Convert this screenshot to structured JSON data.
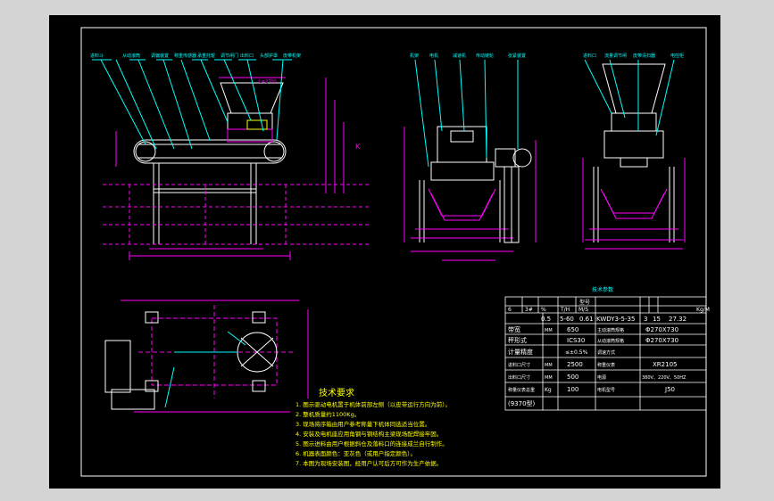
{
  "tech_notes": {
    "title": "技术要求",
    "items": [
      "1. 图示驱动电机置于机体前部左侧（以皮带运行方向为前）。",
      "2. 整机质量约1100Kg。",
      "3. 现场将序箱由用户参考称量下机体同选适当位置。",
      "4. 安装及电机座应用角钢与钢结构主梁现场配焊接牢固。",
      "5. 图示进料由用户根据斜仓及落料口的连接成兰自行制作。",
      "6. 机器表面颜色：亚灰色（或用户指定颜色）。",
      "7. 本图为现场安装图，经用户认可后方可作为生产依据。"
    ]
  },
  "spec_table": {
    "caption": "技术参数",
    "header": [
      "",
      "",
      "精度",
      "流量",
      "带速",
      "型号",
      "",
      "",
      "",
      "Kg/M"
    ],
    "row_units": [
      "6",
      "3#",
      "%",
      "T/H",
      "M/S",
      "",
      "",
      "",
      "",
      ""
    ],
    "row_values": [
      "",
      "",
      "0.5",
      "5-60",
      "0.61",
      "KWDY3-5-35",
      "3",
      "15",
      "27.32"
    ],
    "rows": [
      {
        "label": "带宽",
        "unit": "MM",
        "value": "650",
        "label2": "主动滚筒规格",
        "value2": "Φ270X730"
      },
      {
        "label": "秤形式",
        "unit": "",
        "value": "ICS30",
        "label2": "从动滚筒规格",
        "value2": "Φ270X730"
      },
      {
        "label": "计量精度",
        "unit": "",
        "value": "≤±0.5%",
        "label2": "调速方式",
        "value2": ""
      },
      {
        "label": "进料口尺寸",
        "unit": "MM",
        "value": "2500",
        "label2": "称重仪表",
        "value2": "XR2105"
      },
      {
        "label": "出料口尺寸",
        "unit": "MM",
        "value": "500",
        "label2": "电源",
        "value2": "380V、220V、50HZ"
      },
      {
        "label": "称量仪表总重",
        "unit": "Kg",
        "value": "100",
        "label2": "电机型号",
        "value2": "J50"
      }
    ],
    "note": "(9370型)"
  },
  "callouts": {
    "front": [
      "进料斗",
      "从动滚筒",
      "调偏装置",
      "称重传感器",
      "承重托辊",
      "调节闸门",
      "出料口",
      "头部护罩",
      "皮带机架"
    ],
    "side": [
      "机架",
      "电机",
      "减速机",
      "传动链轮",
      "张紧装置"
    ],
    "end": [
      "进料口",
      "流量调节闸",
      "皮带清扫器",
      "电控柜"
    ]
  },
  "dimension_labels": {
    "height_marker": "K",
    "top_dim": "L=2700"
  },
  "colors": {
    "background": "#000000",
    "frame": "#ffffff",
    "main": "#ffffff",
    "dim": "#ff00ff",
    "callout": "#00ffff",
    "text": "#ffff00",
    "table": "#ffffff",
    "gray": "#d4d4d4"
  }
}
